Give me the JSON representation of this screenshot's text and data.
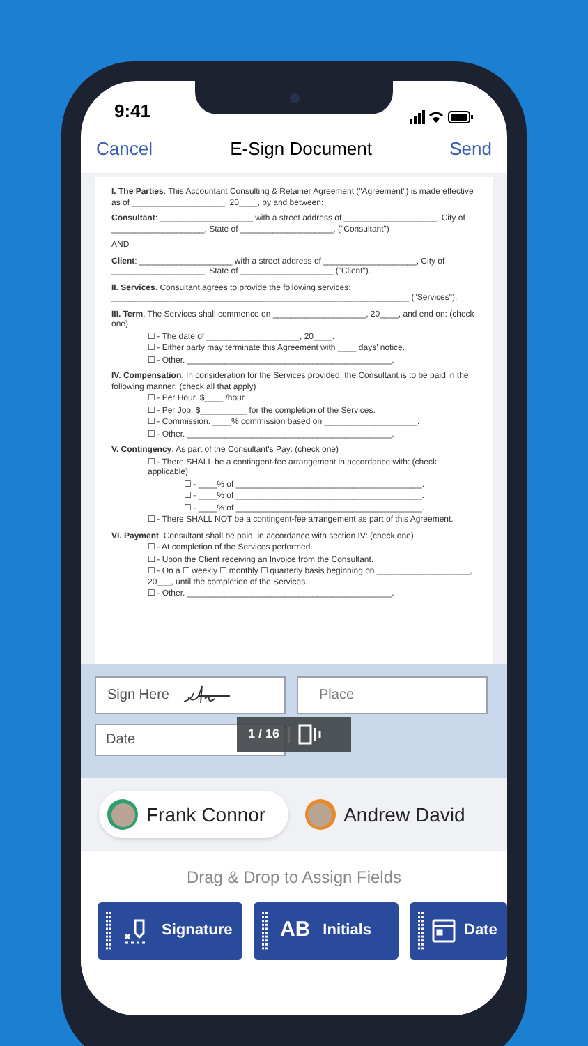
{
  "status_bar": {
    "time": "9:41"
  },
  "nav": {
    "left": "Cancel",
    "title": "E-Sign Document",
    "right": "Send"
  },
  "document": {
    "sections": [
      {
        "text": "**I. The Parties**. This Accountant Consulting & Retainer Agreement (\"Agreement\") is made effective as of ____________________, 20____, by and between:"
      },
      {
        "text": "**Consultant**: ____________________ with a street address of ____________________, City of ____________________, State of ____________________, (\"Consultant\")"
      },
      {
        "text": "AND"
      },
      {
        "text": "**Client**: ____________________ with a street address of ____________________, City of ____________________, State of ____________________ (\"Client\")."
      },
      {
        "text": "**II. Services**. Consultant agrees to provide the following services: ________________________________________________________________ (\"Services\")."
      },
      {
        "text": "**III. Term**. The Services shall commence on ____________________, 20____, and end on: (check one)",
        "children": [
          {
            "text": "☐ - The date of ____________________, 20____."
          },
          {
            "text": "☐ - Either party may terminate this Agreement with ____ days' notice."
          },
          {
            "text": "☐ - Other. ____________________________________________."
          }
        ]
      },
      {
        "text": "**IV. Compensation**. In consideration for the Services provided, the Consultant is to be paid in the following manner: (check all that apply)",
        "children": [
          {
            "text": "☐ - Per Hour. $____ /hour."
          },
          {
            "text": "☐ - Per Job. $__________ for the completion of the Services."
          },
          {
            "text": "☐ - Commission. ____% commission based on ____________________."
          },
          {
            "text": "☐ - Other. ____________________________________________."
          }
        ]
      },
      {
        "text": "**V. Contingency**. As part of the Consultant's Pay: (check one)",
        "children": [
          {
            "text": "☐ - There SHALL be a contingent-fee arrangement in accordance with: (check applicable)",
            "children": [
              {
                "text": "☐ - ____% of ________________________________________."
              },
              {
                "text": "☐ - ____% of ________________________________________."
              },
              {
                "text": "☐ - ____% of ________________________________________."
              }
            ]
          },
          {
            "text": "☐ - There SHALL NOT be a contingent-fee arrangement as part of this Agreement."
          }
        ]
      },
      {
        "text": "**VI. Payment**. Consultant shall be paid, in accordance with section IV: (check one)",
        "children": [
          {
            "text": "☐ - At completion of the Services performed."
          },
          {
            "text": "☐ - Upon the Client receiving an Invoice from the Consultant."
          },
          {
            "text": "☐ - On a ☐ weekly ☐ monthly ☐ quarterly basis beginning on ____________________, 20___, until the completion of the Services."
          },
          {
            "text": "☐ - Other. ____________________________________________."
          }
        ]
      }
    ]
  },
  "fields": [
    {
      "label": "Sign Here"
    },
    {
      "label": "Place"
    },
    {
      "label": "Date"
    }
  ],
  "page_indicator": "1 / 16",
  "signers": [
    {
      "name": "Frank Connor",
      "color": "#2e9e6e",
      "selected": true
    },
    {
      "name": "Andrew David",
      "color": "#e8892a",
      "selected": false
    }
  ],
  "hint": "Drag & Drop to Assign Fields",
  "field_buttons": [
    {
      "kind": "signature",
      "label": "Signature"
    },
    {
      "kind": "initials",
      "icon_text": "AB",
      "label": "Initials"
    },
    {
      "kind": "date",
      "label": "Date"
    }
  ]
}
